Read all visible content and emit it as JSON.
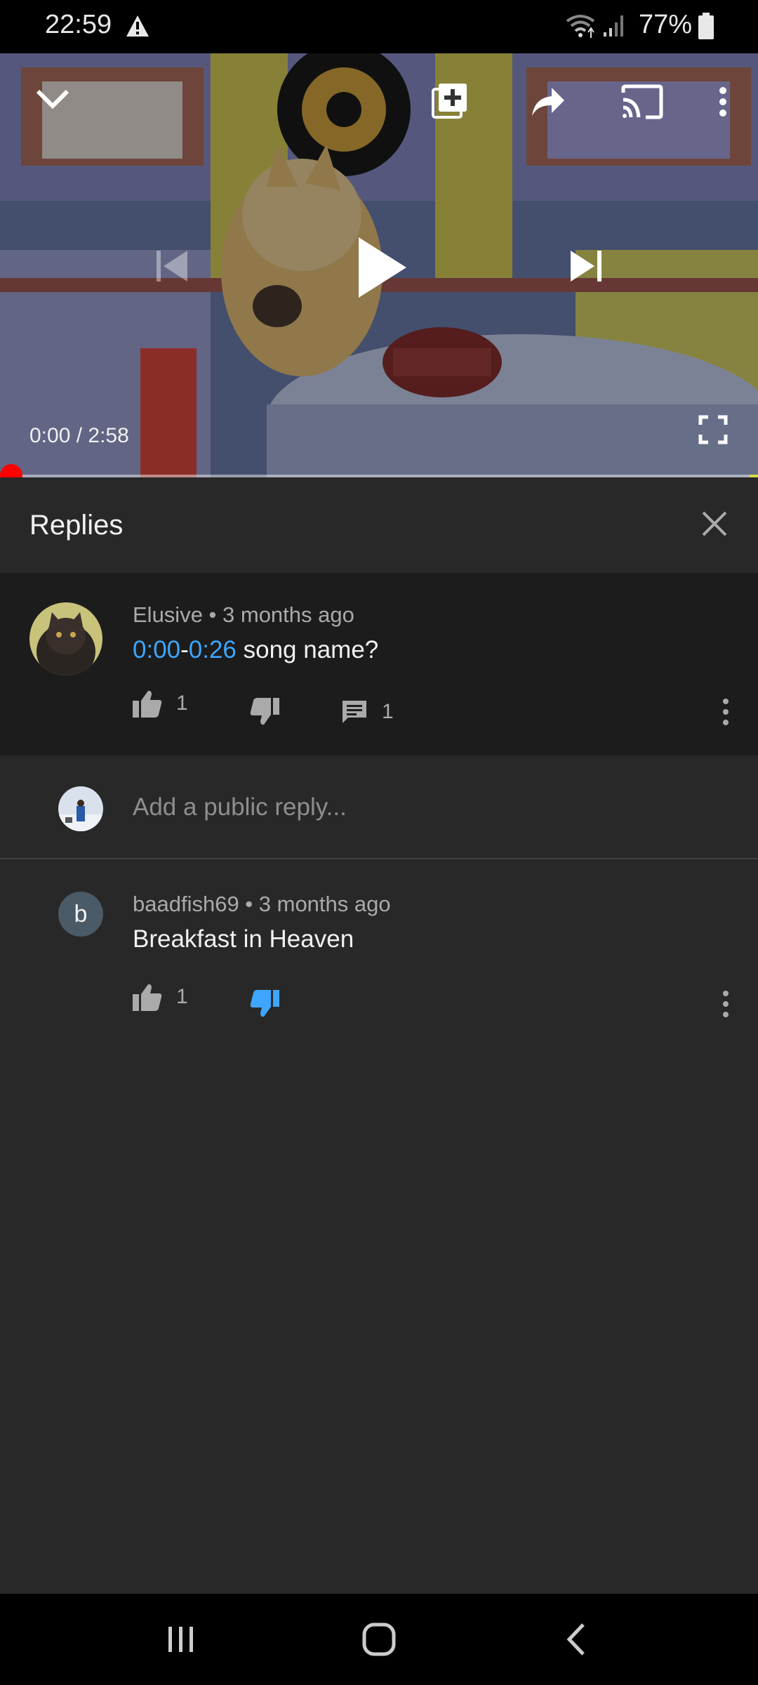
{
  "status_bar": {
    "time": "22:59",
    "battery": "77%"
  },
  "player": {
    "time_readout": "0:00 / 2:58",
    "progress_fraction": 0.0,
    "icons": [
      "chevron-down-icon",
      "add-to-queue-icon",
      "share-icon",
      "cast-icon",
      "more-vert-icon",
      "skip-previous-icon",
      "play-icon",
      "skip-next-icon",
      "fullscreen-icon"
    ]
  },
  "replies": {
    "title": "Replies",
    "parent": {
      "author_meta": "Elusive • 3 months ago",
      "timestamp_start": "0:00",
      "dash": "-",
      "timestamp_end": "0:26",
      "text": " song name?",
      "likes": "1",
      "replies": "1"
    },
    "reply_box": {
      "placeholder": "Add a public reply..."
    },
    "items": [
      {
        "avatar_letter": "b",
        "author_meta": "baadfish69 • 3 months ago",
        "text": "Breakfast in Heaven",
        "likes": "1",
        "disliked": true
      }
    ]
  },
  "colors": {
    "link": "#3ea6ff",
    "progress": "#ff0000",
    "panel": "#282828",
    "highlight_row": "#1c1c1c"
  }
}
